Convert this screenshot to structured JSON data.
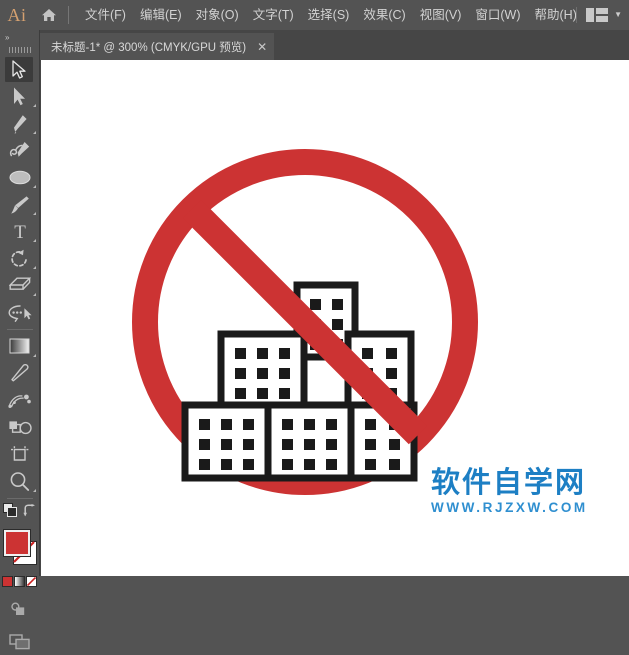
{
  "app": {
    "name": "Ai",
    "logo_color": "#d4a070"
  },
  "menubar": {
    "home_icon": "home-icon",
    "items": [
      {
        "label": "文件(F)"
      },
      {
        "label": "编辑(E)"
      },
      {
        "label": "对象(O)"
      },
      {
        "label": "文字(T)"
      },
      {
        "label": "选择(S)"
      },
      {
        "label": "效果(C)"
      },
      {
        "label": "视图(V)"
      },
      {
        "label": "窗口(W)"
      },
      {
        "label": "帮助(H)"
      }
    ],
    "workspace_icon": "workspace-layout-icon",
    "workspace_chevron": "▼"
  },
  "tabbar": {
    "tabs": [
      {
        "label": "未标题-1* @ 300% (CMYK/GPU 预览)",
        "close_label": "✕",
        "active": true
      }
    ]
  },
  "toolbar": {
    "collapse_label": "»",
    "tools": [
      {
        "name": "selection-tool",
        "selected": true,
        "has_flyout": false
      },
      {
        "name": "direct-selection-tool",
        "selected": false,
        "has_flyout": true
      },
      {
        "name": "pen-tool",
        "selected": false,
        "has_flyout": true
      },
      {
        "name": "curvature-tool",
        "selected": false,
        "has_flyout": false
      },
      {
        "name": "ellipse-tool",
        "selected": false,
        "has_flyout": true
      },
      {
        "name": "paintbrush-tool",
        "selected": false,
        "has_flyout": true
      },
      {
        "name": "type-tool",
        "selected": false,
        "has_flyout": true
      },
      {
        "name": "rotate-tool",
        "selected": false,
        "has_flyout": true
      },
      {
        "name": "eraser-tool",
        "selected": false,
        "has_flyout": true
      },
      {
        "name": "lasso-select-tool",
        "selected": false,
        "has_flyout": false
      },
      {
        "name": "gradient-tool",
        "selected": false,
        "has_flyout": true
      },
      {
        "name": "eyedropper-tool",
        "selected": false,
        "has_flyout": false
      },
      {
        "name": "blend-tool",
        "selected": false,
        "has_flyout": false
      },
      {
        "name": "shape-builder-tool",
        "selected": false,
        "has_flyout": false
      },
      {
        "name": "artboard-tool",
        "selected": false,
        "has_flyout": false
      },
      {
        "name": "zoom-tool",
        "selected": false,
        "has_flyout": true
      }
    ],
    "fill_color": "#cc3333",
    "stroke_color": "#ffffff",
    "swap_icon": "swap-fill-stroke-icon",
    "default_colors_icon": "default-fill-stroke-icon",
    "color_mode_solid": "solid-color-icon",
    "color_mode_gradient": "gradient-icon",
    "color_mode_none": "none-color-icon",
    "drawing_mode_icon": "drawing-mode-icon",
    "screen_mode_icon": "screen-mode-icon"
  },
  "canvas": {
    "zoom_level": "300%",
    "artwork": {
      "name": "no-buildings-prohibition-sign",
      "circle_color": "#cc3333",
      "building_outline_color": "#1a1a1a",
      "building_fill_color": "#ffffff",
      "window_color": "#1a1a1a",
      "buildings": [
        {
          "id": "top-building",
          "window_rows": 3,
          "window_cols": 2
        },
        {
          "id": "middle-left-building",
          "window_rows": 3,
          "window_cols": 3
        },
        {
          "id": "middle-right-building",
          "window_rows": 3,
          "window_cols": 2
        },
        {
          "id": "bottom-left-building",
          "window_rows": 3,
          "window_cols": 3
        },
        {
          "id": "bottom-mid-building",
          "window_rows": 3,
          "window_cols": 3
        },
        {
          "id": "bottom-right-building",
          "window_rows": 3,
          "window_cols": 2
        }
      ]
    }
  },
  "watermark": {
    "chinese": "软件自学网",
    "url": "WWW.RJZXW.COM",
    "color_cn": "#1d7fc4",
    "color_url": "#2f8fd0"
  }
}
